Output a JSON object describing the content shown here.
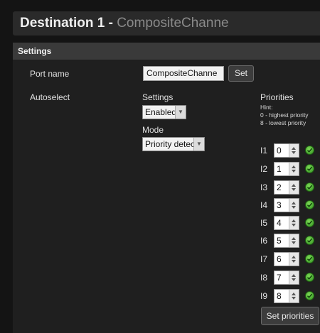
{
  "header": {
    "title_bold": "Destination 1",
    "separator": " - ",
    "title_channel": "CompositeChanne"
  },
  "settings_section": {
    "title": "Settings"
  },
  "port_name": {
    "label": "Port name",
    "value": "CompositeChanne",
    "set_label": "Set"
  },
  "autoselect": {
    "label": "Autoselect",
    "settings_label": "Settings",
    "settings_value": "Enabled",
    "mode_label": "Mode",
    "mode_value": "Priority detect"
  },
  "priorities": {
    "title": "Priorities",
    "hint_title": "Hint:",
    "hint_line1": "0 - highest priority",
    "hint_line2": "8 - lowest priority",
    "rows": [
      {
        "input": "I1",
        "value": "0"
      },
      {
        "input": "I2",
        "value": "1"
      },
      {
        "input": "I3",
        "value": "2"
      },
      {
        "input": "I4",
        "value": "3"
      },
      {
        "input": "I5",
        "value": "4"
      },
      {
        "input": "I6",
        "value": "5"
      },
      {
        "input": "I7",
        "value": "6"
      },
      {
        "input": "I8",
        "value": "7"
      },
      {
        "input": "I9",
        "value": "8"
      }
    ],
    "set_label": "Set priorities"
  },
  "colors": {
    "background": "#141414",
    "panel": "#1f1f1f",
    "header_bar": "#3a3a3a",
    "check_green": "#4cb83a"
  },
  "icons": [
    "spinner-up-icon",
    "spinner-down-icon",
    "dropdown-arrow-icon",
    "green-check-icon"
  ]
}
